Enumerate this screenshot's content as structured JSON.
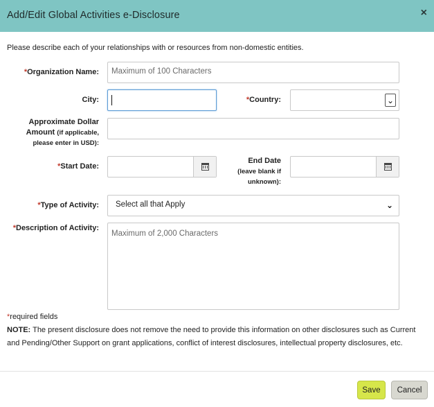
{
  "header": {
    "title": "Add/Edit Global Activities e-Disclosure",
    "close": "×"
  },
  "intro": "Please describe each of your relationships with or resources from non-domestic entities.",
  "required_marker": "*",
  "form": {
    "org_name": {
      "label": "Organization Name:",
      "placeholder": "Maximum of 100 Characters"
    },
    "city": {
      "label": "City:",
      "value": ""
    },
    "country": {
      "label": "Country:",
      "value": ""
    },
    "amount": {
      "label_main": "Approximate Dollar",
      "label_amount": "Amount",
      "label_note1": "(if applicable,",
      "label_note2": "please enter in USD):",
      "value": ""
    },
    "start_date": {
      "label": "Start Date:",
      "value": ""
    },
    "end_date": {
      "label": "End Date",
      "note1": "(leave blank if",
      "note2": "unknown):",
      "value": ""
    },
    "activity_type": {
      "label": "Type of Activity:",
      "value": "Select all that Apply"
    },
    "description": {
      "label": "Description of Activity:",
      "placeholder": "Maximum of 2,000 Characters"
    }
  },
  "footer": {
    "required_note": "required fields",
    "note_label": "NOTE:",
    "note_text": "The present disclosure does not remove the need to provide this information on other disclosures such as Current and Pending/Other Support on grant applications, conflict of interest disclosures, intellectual property disclosures, etc."
  },
  "buttons": {
    "save": "Save",
    "cancel": "Cancel"
  },
  "colors": {
    "header": "#7fc5c3",
    "save": "#d6e64a",
    "cancel": "#d8d8d0",
    "required": "#c0392b",
    "focus": "#5b9bd5"
  }
}
